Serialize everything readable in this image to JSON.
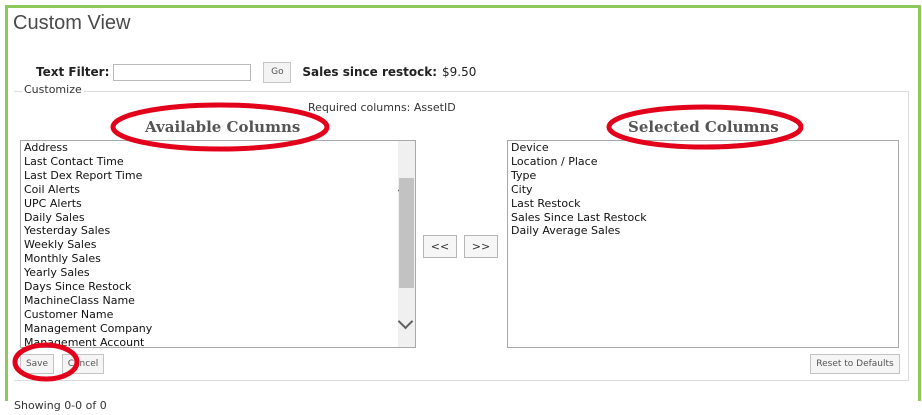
{
  "page": {
    "title": "Custom View"
  },
  "filter": {
    "label": "Text Filter:",
    "value": "",
    "placeholder": "",
    "go_label": "Go",
    "sales_label": "Sales since restock:",
    "sales_value": "$9.50"
  },
  "customize": {
    "legend": "Customize",
    "required_text": "Required columns: AssetID",
    "available_title": "Available Columns",
    "selected_title": "Selected Columns",
    "available_items": [
      "Address",
      "Last Contact Time",
      "Last Dex Report Time",
      "Coil Alerts",
      "UPC Alerts",
      "Daily Sales",
      "Yesterday Sales",
      "Weekly Sales",
      "Monthly Sales",
      "Yearly Sales",
      "Days Since Restock",
      "MachineClass Name",
      "Customer Name",
      "Management Company",
      "Management Account"
    ],
    "selected_items": [
      "Device",
      "Location / Place",
      "Type",
      "City",
      "Last Restock",
      "Sales Since Last Restock",
      "Daily Average Sales"
    ],
    "move_left_label": "<<",
    "move_right_label": ">>",
    "save_label": "Save",
    "cancel_label": "Cancel",
    "reset_label": "Reset to Defaults"
  },
  "status": {
    "text": "Showing 0-0 of 0"
  },
  "colors": {
    "frame_border": "#8cc85a",
    "annotation_red": "#e3001b"
  }
}
